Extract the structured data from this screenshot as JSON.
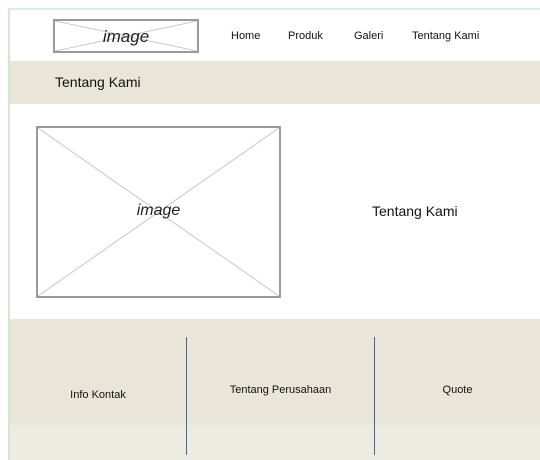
{
  "header": {
    "logo_label": "image",
    "nav": {
      "home": "Home",
      "produk": "Produk",
      "galeri": "Galeri",
      "tentang": "Tentang Kami"
    }
  },
  "title_band": {
    "title": "Tentang Kami"
  },
  "content": {
    "image_label": "image",
    "text": "Tentang Kami"
  },
  "footer": {
    "columns": [
      {
        "label": "Info Kontak"
      },
      {
        "label": "Tentang Perusahaan"
      },
      {
        "label": "Quote"
      }
    ]
  },
  "colors": {
    "band_background": "#e9e6d9",
    "placeholder_border": "#9a9a9a",
    "divider": "#5a6478"
  }
}
